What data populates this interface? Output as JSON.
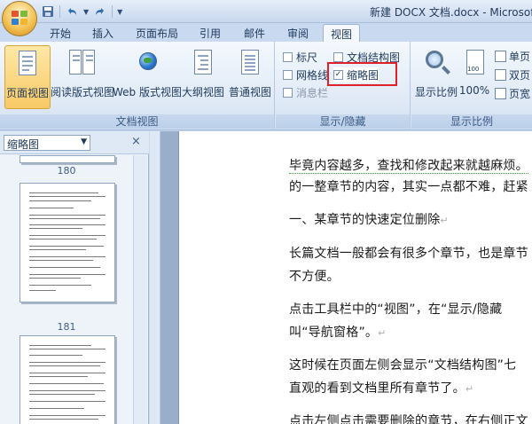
{
  "window": {
    "title": "新建 DOCX 文档.docx - Microsoft"
  },
  "qat": {
    "undo_icon": "undo-icon",
    "redo_icon": "redo-icon",
    "save_icon": "save-icon"
  },
  "tabs": [
    {
      "label": "开始"
    },
    {
      "label": "插入"
    },
    {
      "label": "页面布局"
    },
    {
      "label": "引用"
    },
    {
      "label": "邮件"
    },
    {
      "label": "审阅"
    },
    {
      "label": "视图",
      "active": true
    }
  ],
  "ribbon": {
    "doc_views": {
      "group_label": "文档视图",
      "buttons": [
        {
          "label": "页面视图",
          "selected": true
        },
        {
          "label": "阅读版式视图"
        },
        {
          "label": "Web 版式视图"
        },
        {
          "label": "大纲视图"
        },
        {
          "label": "普通视图"
        }
      ]
    },
    "show_hide": {
      "group_label": "显示/隐藏",
      "ruler": "标尺",
      "gridlines": "网格线",
      "message_bar": "消息栏",
      "doc_map": "文档结构图",
      "thumbnails": "缩略图",
      "thumbnails_checked": "✓"
    },
    "zoom": {
      "group_label": "显示比例",
      "zoom_label": "显示比例",
      "zoom_100": "100%",
      "zoom_100_icon_text": "100",
      "one_page": "单页",
      "two_pages": "双页",
      "page_width": "页宽"
    }
  },
  "pane": {
    "select_value": "缩略图",
    "close": "×",
    "pages": [
      "180",
      "181"
    ]
  },
  "document": {
    "paragraphs": [
      "毕竟内容越多，查找和修改起来就越麻烦。",
      "的一整章节的内容，其实一点都不难，赶紧",
      "一、某章节的快速定位删除",
      "长篇文档一般都会有很多个章节，也是章节",
      "不方便。",
      "点击工具栏中的“视图”，在“显示/隐藏",
      "叫“导航窗格”。",
      "这时候在页面左侧会显示“文档结构图”七",
      "直观的看到文档里所有章节了。",
      "点击左侧点击需要删除的章节，在右侧正文"
    ],
    "return_mark": "↵"
  }
}
